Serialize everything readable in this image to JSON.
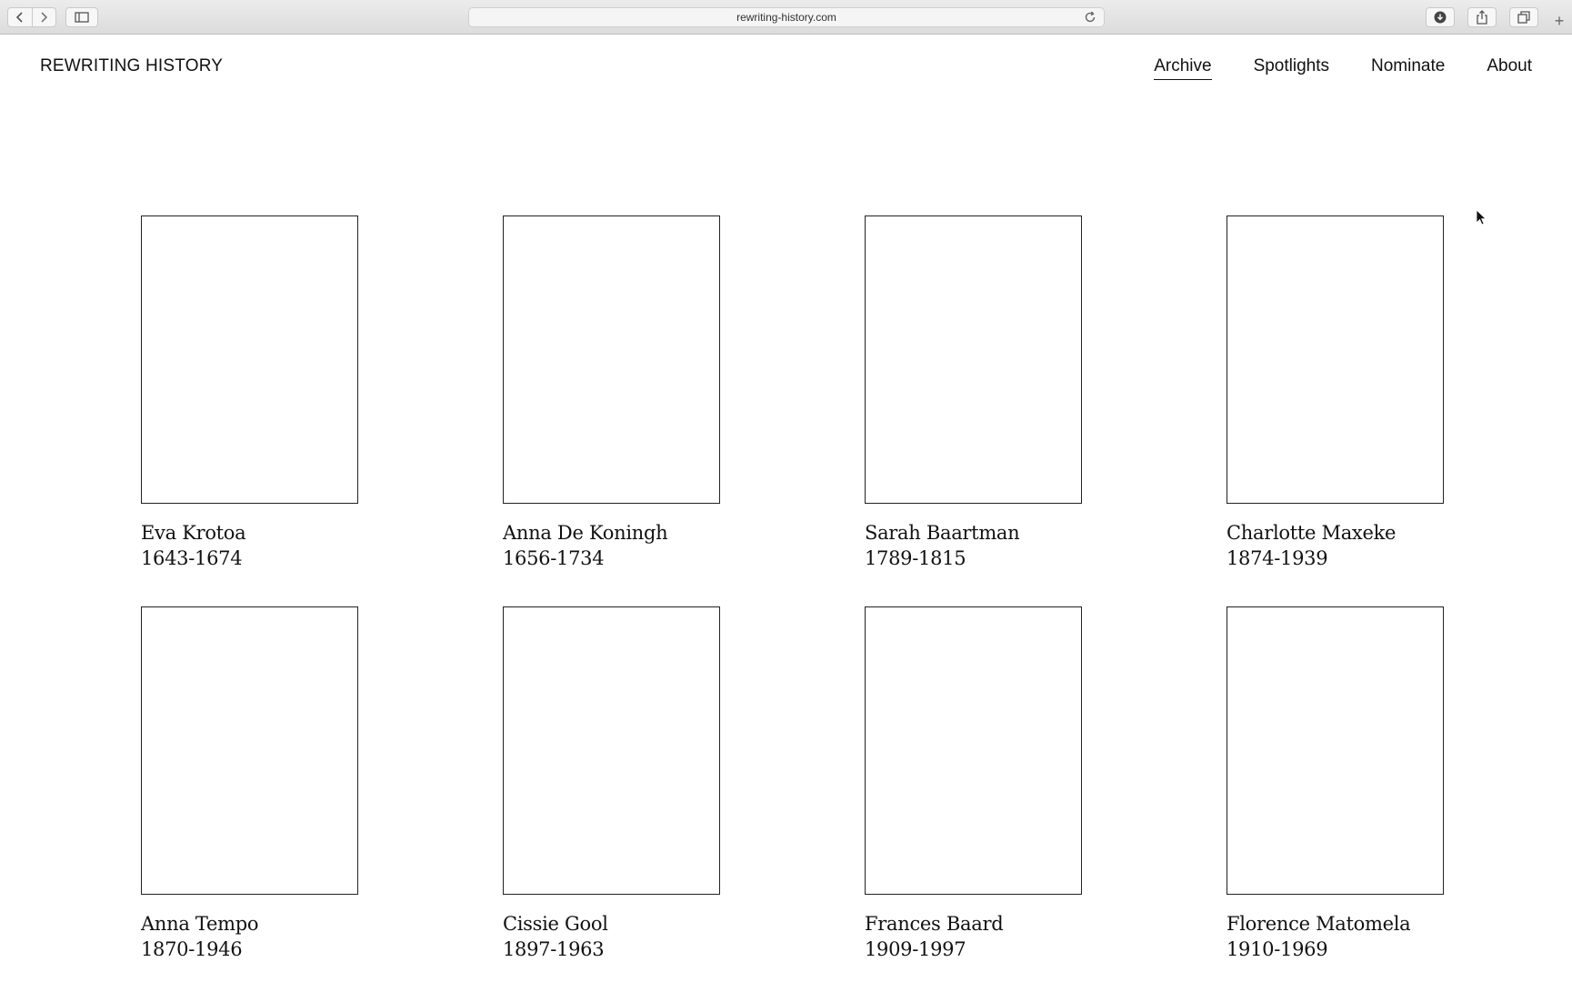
{
  "browser": {
    "url": "rewriting-history.com",
    "new_tab_glyph": "+"
  },
  "site": {
    "title": "REWRITING HISTORY",
    "nav": [
      {
        "label": "Archive",
        "active": true
      },
      {
        "label": "Spotlights",
        "active": false
      },
      {
        "label": "Nominate",
        "active": false
      },
      {
        "label": "About",
        "active": false
      }
    ]
  },
  "people": [
    {
      "name": "Eva Krotoa",
      "years": "1643-1674"
    },
    {
      "name": "Anna De Koningh",
      "years": "1656-1734"
    },
    {
      "name": "Sarah Baartman",
      "years": "1789-1815"
    },
    {
      "name": "Charlotte Maxeke",
      "years": "1874-1939"
    },
    {
      "name": "Anna Tempo",
      "years": "1870-1946"
    },
    {
      "name": "Cissie Gool",
      "years": "1897-1963"
    },
    {
      "name": "Frances Baard",
      "years": "1909-1997"
    },
    {
      "name": "Florence Matomela",
      "years": "1910-1969"
    }
  ],
  "icons": {
    "back": "chevron-left-icon",
    "forward": "chevron-right-icon",
    "sidebar": "sidebar-icon",
    "reload": "reload-icon",
    "download": "download-icon",
    "share": "share-icon",
    "tabs": "tabs-icon",
    "cursor": "cursor-icon"
  },
  "colors": {
    "text": "#111111",
    "border": "#222222",
    "background": "#ffffff"
  }
}
